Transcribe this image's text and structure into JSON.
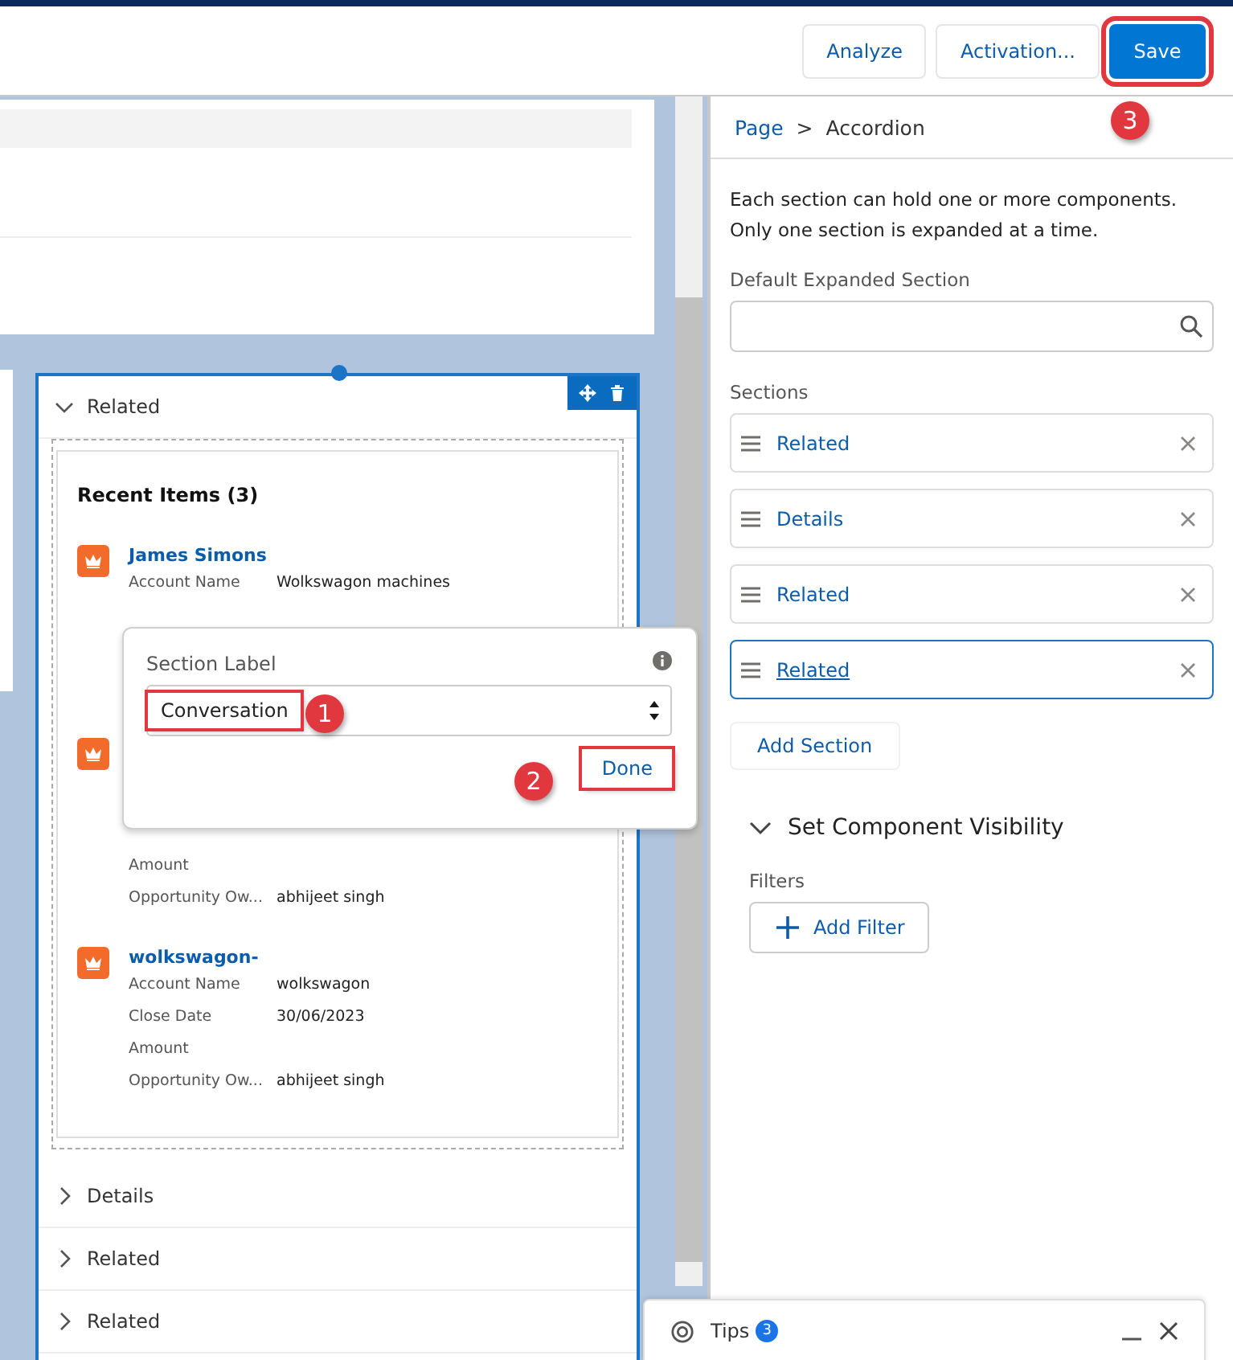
{
  "toolbar": {
    "buttons": [
      {
        "label": "Analyze",
        "kind": "neutral",
        "highlighted": false
      },
      {
        "label": "Activation...",
        "kind": "neutral",
        "highlighted": false
      },
      {
        "label": "Save",
        "kind": "brand",
        "highlighted": true
      }
    ]
  },
  "canvas": {
    "accordion": {
      "sections": [
        {
          "label": "Related",
          "expanded": true
        },
        {
          "label": "Details",
          "expanded": false
        },
        {
          "label": "Related",
          "expanded": false
        },
        {
          "label": "Related",
          "expanded": false
        }
      ],
      "recent_items": {
        "title": "Recent Items (3)",
        "items": [
          {
            "name": "James Simons",
            "fields": [
              {
                "label": "Account Name",
                "value": "Wolkswagon machines"
              }
            ]
          },
          {
            "fields": [
              {
                "label": "Amount"
              },
              {
                "label": "Opportunity Ow...",
                "value": "abhijeet singh"
              }
            ]
          },
          {
            "name": "wolkswagon-",
            "fields": [
              {
                "label": "Account Name",
                "value": "wolkswagon"
              },
              {
                "label": "Close Date",
                "value": "30/06/2023"
              },
              {
                "label": "Amount"
              },
              {
                "label": "Opportunity Ow...",
                "value": "abhijeet singh"
              }
            ]
          }
        ]
      }
    }
  },
  "popover": {
    "label": "Section Label",
    "value": "Conversation",
    "value_highlighted": true,
    "button": "Done",
    "button_highlighted": true
  },
  "panel": {
    "breadcrumb": [
      {
        "label": "Page",
        "kind": "link"
      },
      {
        "label": ">",
        "kind": "separator"
      },
      {
        "label": "Accordion",
        "kind": "current"
      }
    ],
    "description": [
      "Each section can hold one or more components.",
      "Only one section is expanded at a time."
    ],
    "default_label": "Default Expanded Section",
    "sections_label": "Sections",
    "sections": [
      {
        "label": "Related",
        "selected": false
      },
      {
        "label": "Details",
        "selected": false
      },
      {
        "label": "Related",
        "selected": false
      },
      {
        "label": "Related",
        "selected": true
      }
    ],
    "add_section": "Add Section",
    "visibility": {
      "title": "Set Component Visibility",
      "expanded": true,
      "filters_label": "Filters",
      "add_filter": "Add Filter"
    }
  },
  "tips": {
    "label": "Tips",
    "count": "3"
  },
  "annotations": [
    {
      "number": "1"
    },
    {
      "number": "2"
    },
    {
      "number": "3"
    }
  ]
}
